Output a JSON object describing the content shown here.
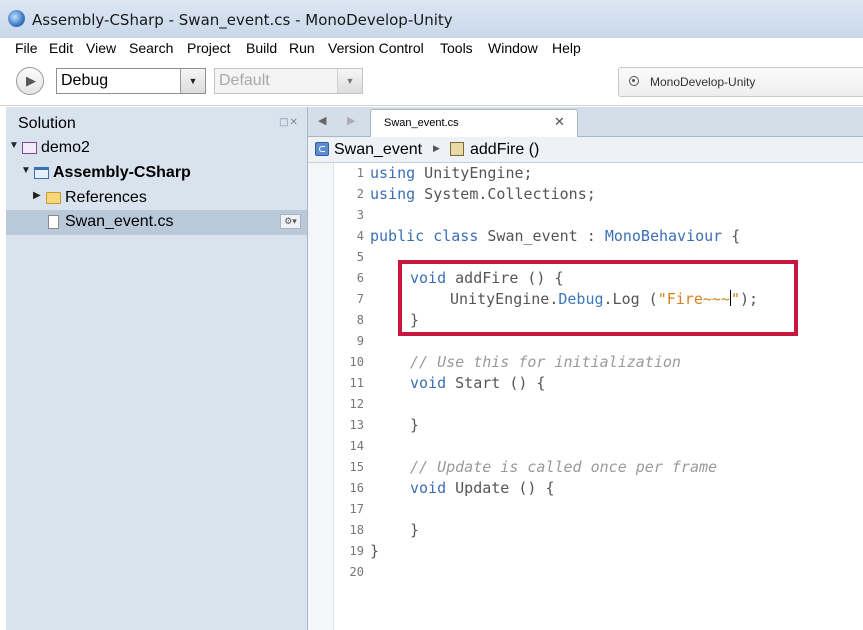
{
  "window": {
    "title": "Assembly-CSharp - Swan_event.cs - MonoDevelop-Unity"
  },
  "menu": [
    "File",
    "Edit",
    "View",
    "Search",
    "Project",
    "Build",
    "Run",
    "Version Control",
    "Tools",
    "Window",
    "Help"
  ],
  "toolbar": {
    "config_value": "Debug",
    "platform_value": "Default",
    "status_text": "MonoDevelop-Unity"
  },
  "solution_pad": {
    "title": "Solution",
    "tree": [
      {
        "label": "demo2",
        "type": "solution",
        "expanded": true
      },
      {
        "label": "Assembly-CSharp",
        "type": "project",
        "expanded": true
      },
      {
        "label": "References",
        "type": "folder",
        "expanded": false
      },
      {
        "label": "Swan_event.cs",
        "type": "file",
        "selected": true
      }
    ]
  },
  "editor": {
    "tab_label": "Swan_event.cs",
    "path": {
      "class_name": "Swan_event",
      "method_name": "addFire ()"
    },
    "line_numbers": [
      "1",
      "2",
      "3",
      "4",
      "5",
      "6",
      "7",
      "8",
      "9",
      "10",
      "11",
      "12",
      "13",
      "14",
      "15",
      "16",
      "17",
      "18",
      "19",
      "20"
    ],
    "code": {
      "l1_using": "using",
      "l1_ns": " UnityEngine;",
      "l2_using": "using",
      "l2_ns": " System.Collections;",
      "l4_kw": "public class",
      "l4_name": " Swan_event : ",
      "l4_base": "MonoBehaviour",
      "l4_brace": " {",
      "l6_kw": "void",
      "l6_rest": " addFire () {",
      "l7_a": "UnityEngine.",
      "l7_debug": "Debug",
      "l7_b": ".Log (",
      "l7_str": "\"Fire~~~",
      "l7_str_end": "\"",
      "l7_c": ");",
      "l8": "}",
      "l10": "// Use this for initialization",
      "l11_kw": "void",
      "l11_rest": " Start () {",
      "l13": "}",
      "l15": "// Update is called once per frame",
      "l16_kw": "void",
      "l16_rest": " Update () {",
      "l18": "}",
      "l19": "}"
    }
  },
  "colors": {
    "keyword": "#3a6fb5",
    "comment": "#9a9a9a",
    "string": "#d4811e",
    "highlight_border": "#c8163f",
    "pad_bg": "#d9e3ee"
  }
}
